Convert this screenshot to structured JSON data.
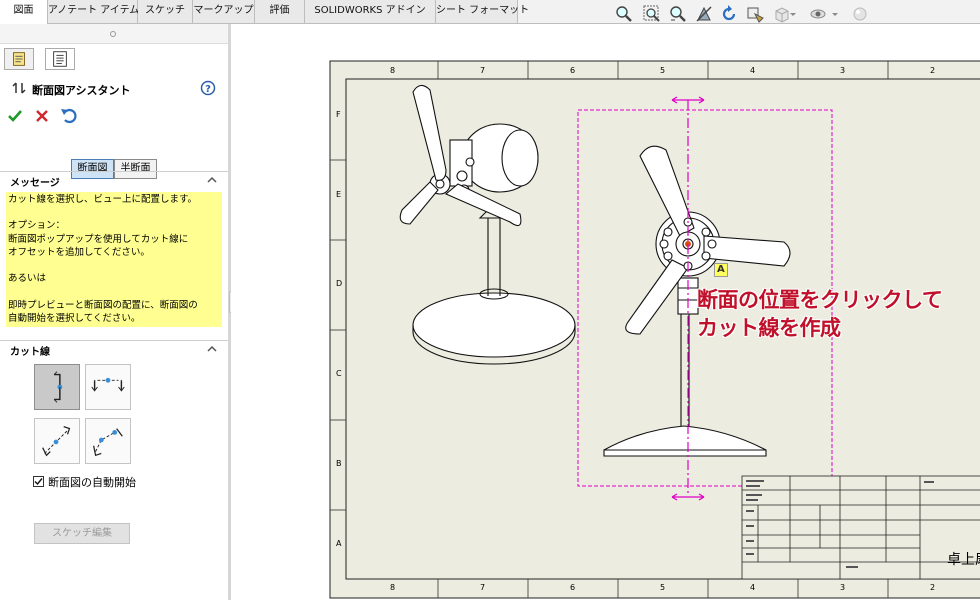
{
  "tabs": [
    "図面",
    "アノテート アイテム",
    "スケッチ",
    "マークアップ",
    "評価",
    "SOLIDWORKS アドイン",
    "シート フォーマット"
  ],
  "view_toolbar_icons": [
    "zoom-to-fit-icon",
    "zoom-to-area-icon",
    "zoom-in-out-icon",
    "pan-icon",
    "rotate-icon",
    "3d-drawing-view-icon",
    "display-style-icon",
    "hide-show-icon",
    "appearance-icon"
  ],
  "panel": {
    "tabs_icons": [
      "feature-manager-icon",
      "property-manager-icon"
    ],
    "title": "断面図アシスタント",
    "mode_buttons": [
      "断面図",
      "半断面"
    ],
    "messages_header": "メッセージ",
    "message": "カット線を選択し、ビュー上に配置します。\n\nオプション：\n断面図ポップアップを使用してカット線に\nオフセットを追加してください。\n\nあるいは\n\n即時プレビューと断面図の配置に、断面図の\n自動開始を選択してください。",
    "cutline_header": "カット線",
    "cutline_types": [
      "vertical-cutline-icon",
      "horizontal-cutline-icon",
      "auxiliary-cutline-icon",
      "aligned-cutline-icon"
    ],
    "auto_start_label": "断面図の自動開始",
    "auto_start_checked": true,
    "edit_sketch_label": "スケッチ編集"
  },
  "drawing": {
    "top_zones": [
      "8",
      "7",
      "6",
      "5",
      "4",
      "3",
      "2"
    ],
    "bottom_zones": [
      "8",
      "7",
      "6",
      "5",
      "4",
      "3",
      "2"
    ],
    "left_zones": [
      "F",
      "E",
      "D",
      "C",
      "B",
      "A"
    ],
    "cut_label": "A",
    "annotation_line1": "断面の位置をクリックして",
    "annotation_line2": "カット線を作成",
    "title_block_title": "卓上扇"
  },
  "colors": {
    "sheet": "#ecece0",
    "cutline": "#e000c8",
    "annotation": "#c0102a",
    "message_bg": "#ffff91"
  }
}
